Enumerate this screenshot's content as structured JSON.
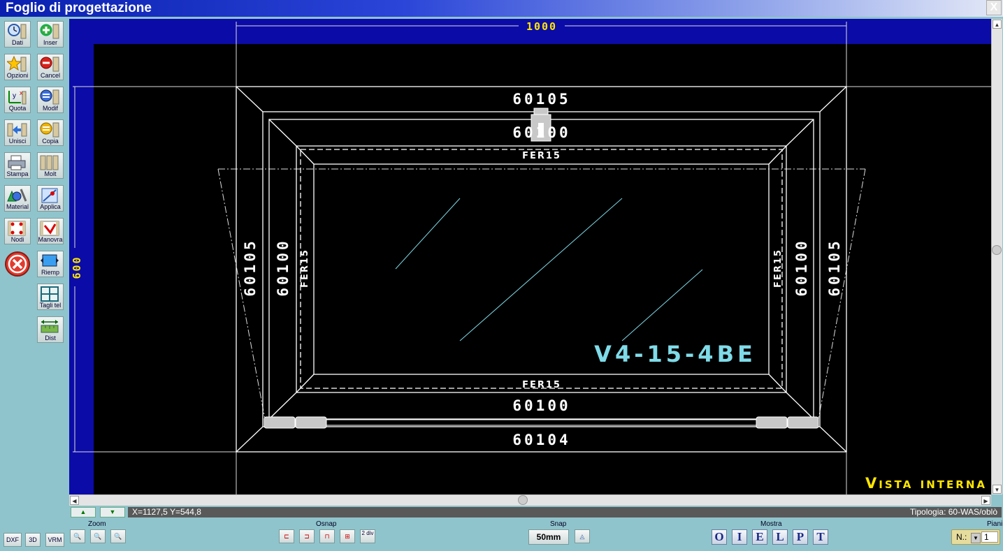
{
  "window": {
    "title": "Foglio di progettazione",
    "close_label": "X"
  },
  "toolbar": {
    "left": [
      "Dati",
      "Opzioni",
      "Quota",
      "Unisci",
      "Stampa",
      "Material",
      "Nodi",
      ""
    ],
    "right": [
      "Inser",
      "Cancel",
      "Modif",
      "Copia",
      "Molt",
      "Applica",
      "Manovra",
      "Riemp",
      "Tagli tel",
      "Dist"
    ]
  },
  "drawing": {
    "dim_width": "1000",
    "dim_height": "600",
    "profile_outer_top": "60105",
    "profile_inner_top": "60100",
    "fer_top": "FER15",
    "fer_bottom": "FER15",
    "fer_left": "FER15",
    "fer_right": "FER15",
    "profile_left_outer": "60105",
    "profile_left_inner": "60100",
    "profile_right_outer": "60105",
    "profile_right_inner": "60100",
    "profile_inner_bottom": "60100",
    "profile_outer_bottom": "60104",
    "glass_code": "V4-15-4BE",
    "view_label": "Vista interna"
  },
  "status": {
    "coords": "X=1127,5  Y=544,8",
    "tipologia": "Tipologia: 60-WAS/oblò"
  },
  "bottom": {
    "left_buttons": [
      "DXF",
      "3D",
      "VRM"
    ],
    "zoom_label": "Zoom",
    "osnap_label": "Osnap",
    "osnap_div": "2 div",
    "snap_label": "Snap",
    "snap_value": "50mm",
    "mostra_label": "Mostra",
    "mostra_buttons": [
      "O",
      "I",
      "E",
      "L",
      "P",
      "T"
    ],
    "piani_label": "Piani",
    "piani_prefix": "N.:",
    "piani_value": "1"
  },
  "colors": {
    "accent_yellow": "#ffe600",
    "glass_cyan": "#7fdbe8",
    "canvas_blue": "#0b0ba8"
  }
}
